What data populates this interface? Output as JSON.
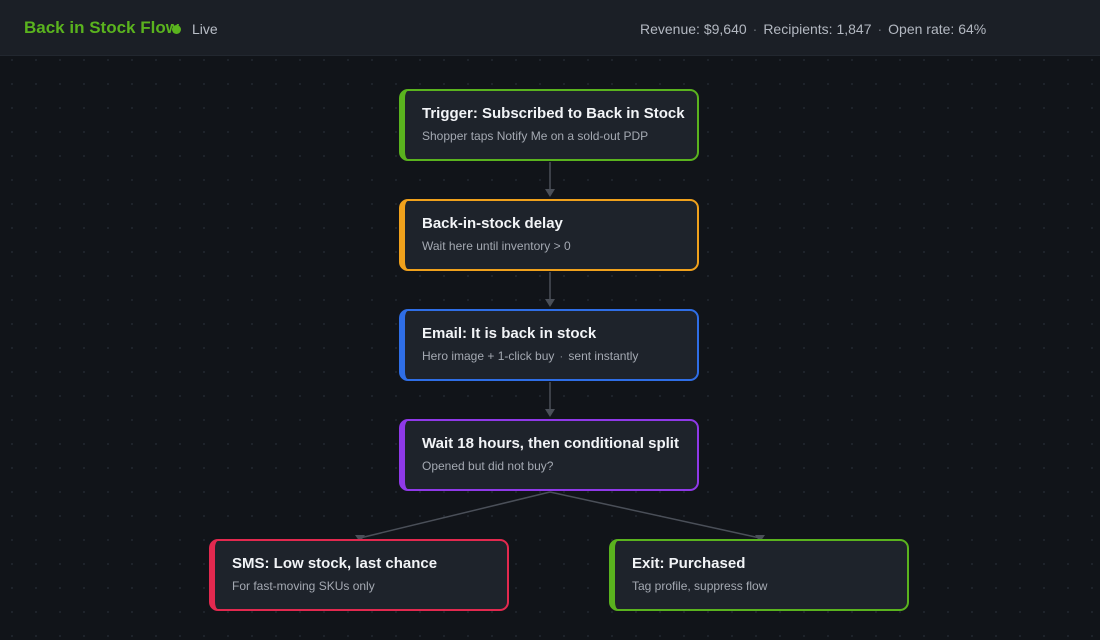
{
  "header": {
    "flow_title": "Back in Stock Flow",
    "status_label": "Live",
    "status_color": "#5ab31e",
    "stats": {
      "revenue": "Revenue: $9,640",
      "recipients": "Recipients: 1,847",
      "open_rate": "Open rate: 64%",
      "separator": "·"
    }
  },
  "nodes": {
    "trigger": {
      "title": "Trigger: Subscribed to Back in Stock",
      "subtitle": "Shopper taps Notify Me on a sold-out PDP",
      "accent": "#5ab31e"
    },
    "delay": {
      "title": "Back-in-stock delay",
      "subtitle": "Wait here until inventory > 0",
      "accent": "#f0a11c"
    },
    "email": {
      "title": "Email: It is back in stock",
      "subtitle_a": "Hero image + 1-click buy",
      "subtitle_sep": "·",
      "subtitle_b": "sent instantly",
      "accent": "#2f6ee6"
    },
    "wait": {
      "title": "Wait 18 hours, then conditional split",
      "subtitle": "Opened but did not buy?",
      "accent": "#8f39e8"
    },
    "sms": {
      "title": "SMS: Low stock, last chance",
      "subtitle": "For fast-moving SKUs only",
      "accent": "#e3294f"
    },
    "exit": {
      "title": "Exit: Purchased",
      "subtitle": "Tag profile, suppress flow",
      "accent": "#5ab31e"
    }
  }
}
